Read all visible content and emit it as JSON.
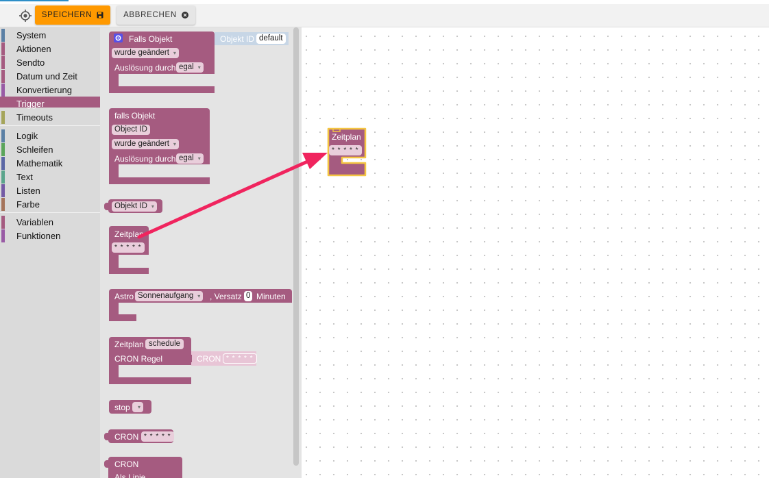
{
  "toolbar": {
    "save_label": "SPEICHERN",
    "cancel_label": "ABBRECHEN",
    "locate_icon": "crosshair-icon",
    "save_icon": "floppy-icon",
    "cancel_icon": "close-circle-icon"
  },
  "colors": {
    "save": "#ff9900",
    "block": "#a55b80",
    "selected": "#a55b80",
    "highlight": "#f4c542",
    "arrow": "#f0245e"
  },
  "sidebar": {
    "items": [
      {
        "label": "System",
        "color": "#5b80a5"
      },
      {
        "label": "Aktionen",
        "color": "#a55b80"
      },
      {
        "label": "Sendto",
        "color": "#a55b80"
      },
      {
        "label": "Datum und Zeit",
        "color": "#a55b80"
      },
      {
        "label": "Konvertierung",
        "color": "#a55b80"
      },
      {
        "label": "Trigger",
        "color": "#a55b80",
        "selected": true
      },
      {
        "label": "Timeouts",
        "color": "#a5a55b"
      },
      {
        "label": "Logik",
        "color": "#5b80a5"
      },
      {
        "label": "Schleifen",
        "color": "#5ba55b"
      },
      {
        "label": "Mathematik",
        "color": "#5b67a5"
      },
      {
        "label": "Text",
        "color": "#5ba58c"
      },
      {
        "label": "Listen",
        "color": "#745ba5"
      },
      {
        "label": "Farbe",
        "color": "#a5745b"
      },
      {
        "label": "Variablen",
        "color": "#a55b80"
      },
      {
        "label": "Funktionen",
        "color": "#995ba5"
      }
    ]
  },
  "flyout": {
    "b1": {
      "title": "Falls Objekt",
      "gear_icon": "gear-icon",
      "objid_label": "Objekt ID",
      "objid_value": "default",
      "changed": "wurde geändert",
      "trigger_label": "Auslösung durch",
      "trigger_value": "egal"
    },
    "b2": {
      "title": "falls Objekt",
      "objid": "Object ID",
      "changed": "wurde geändert",
      "trigger_label": "Auslösung durch",
      "trigger_value": "egal"
    },
    "b3": {
      "objid": "Objekt ID"
    },
    "b4": {
      "title": "Zeitplan",
      "value": "* * * * *"
    },
    "b5": {
      "astro": "Astro",
      "event": "Sonnenaufgang",
      "offset_label": ", Versatz",
      "offset_value": "0",
      "minutes": "Minuten"
    },
    "b6": {
      "title": "Zeitplan",
      "name": "schedule",
      "cron_label": "CRON Regel",
      "cron": "CRON",
      "cron_value": "* * * * *"
    },
    "b7": {
      "label": "stop"
    },
    "b8": {
      "label": "CRON",
      "value": "* * * * *"
    },
    "b9": {
      "label": "CRON",
      "line": "Als Linie"
    }
  },
  "workspace": {
    "block": {
      "title": "Zeitplan",
      "value": "* * * * *"
    }
  }
}
